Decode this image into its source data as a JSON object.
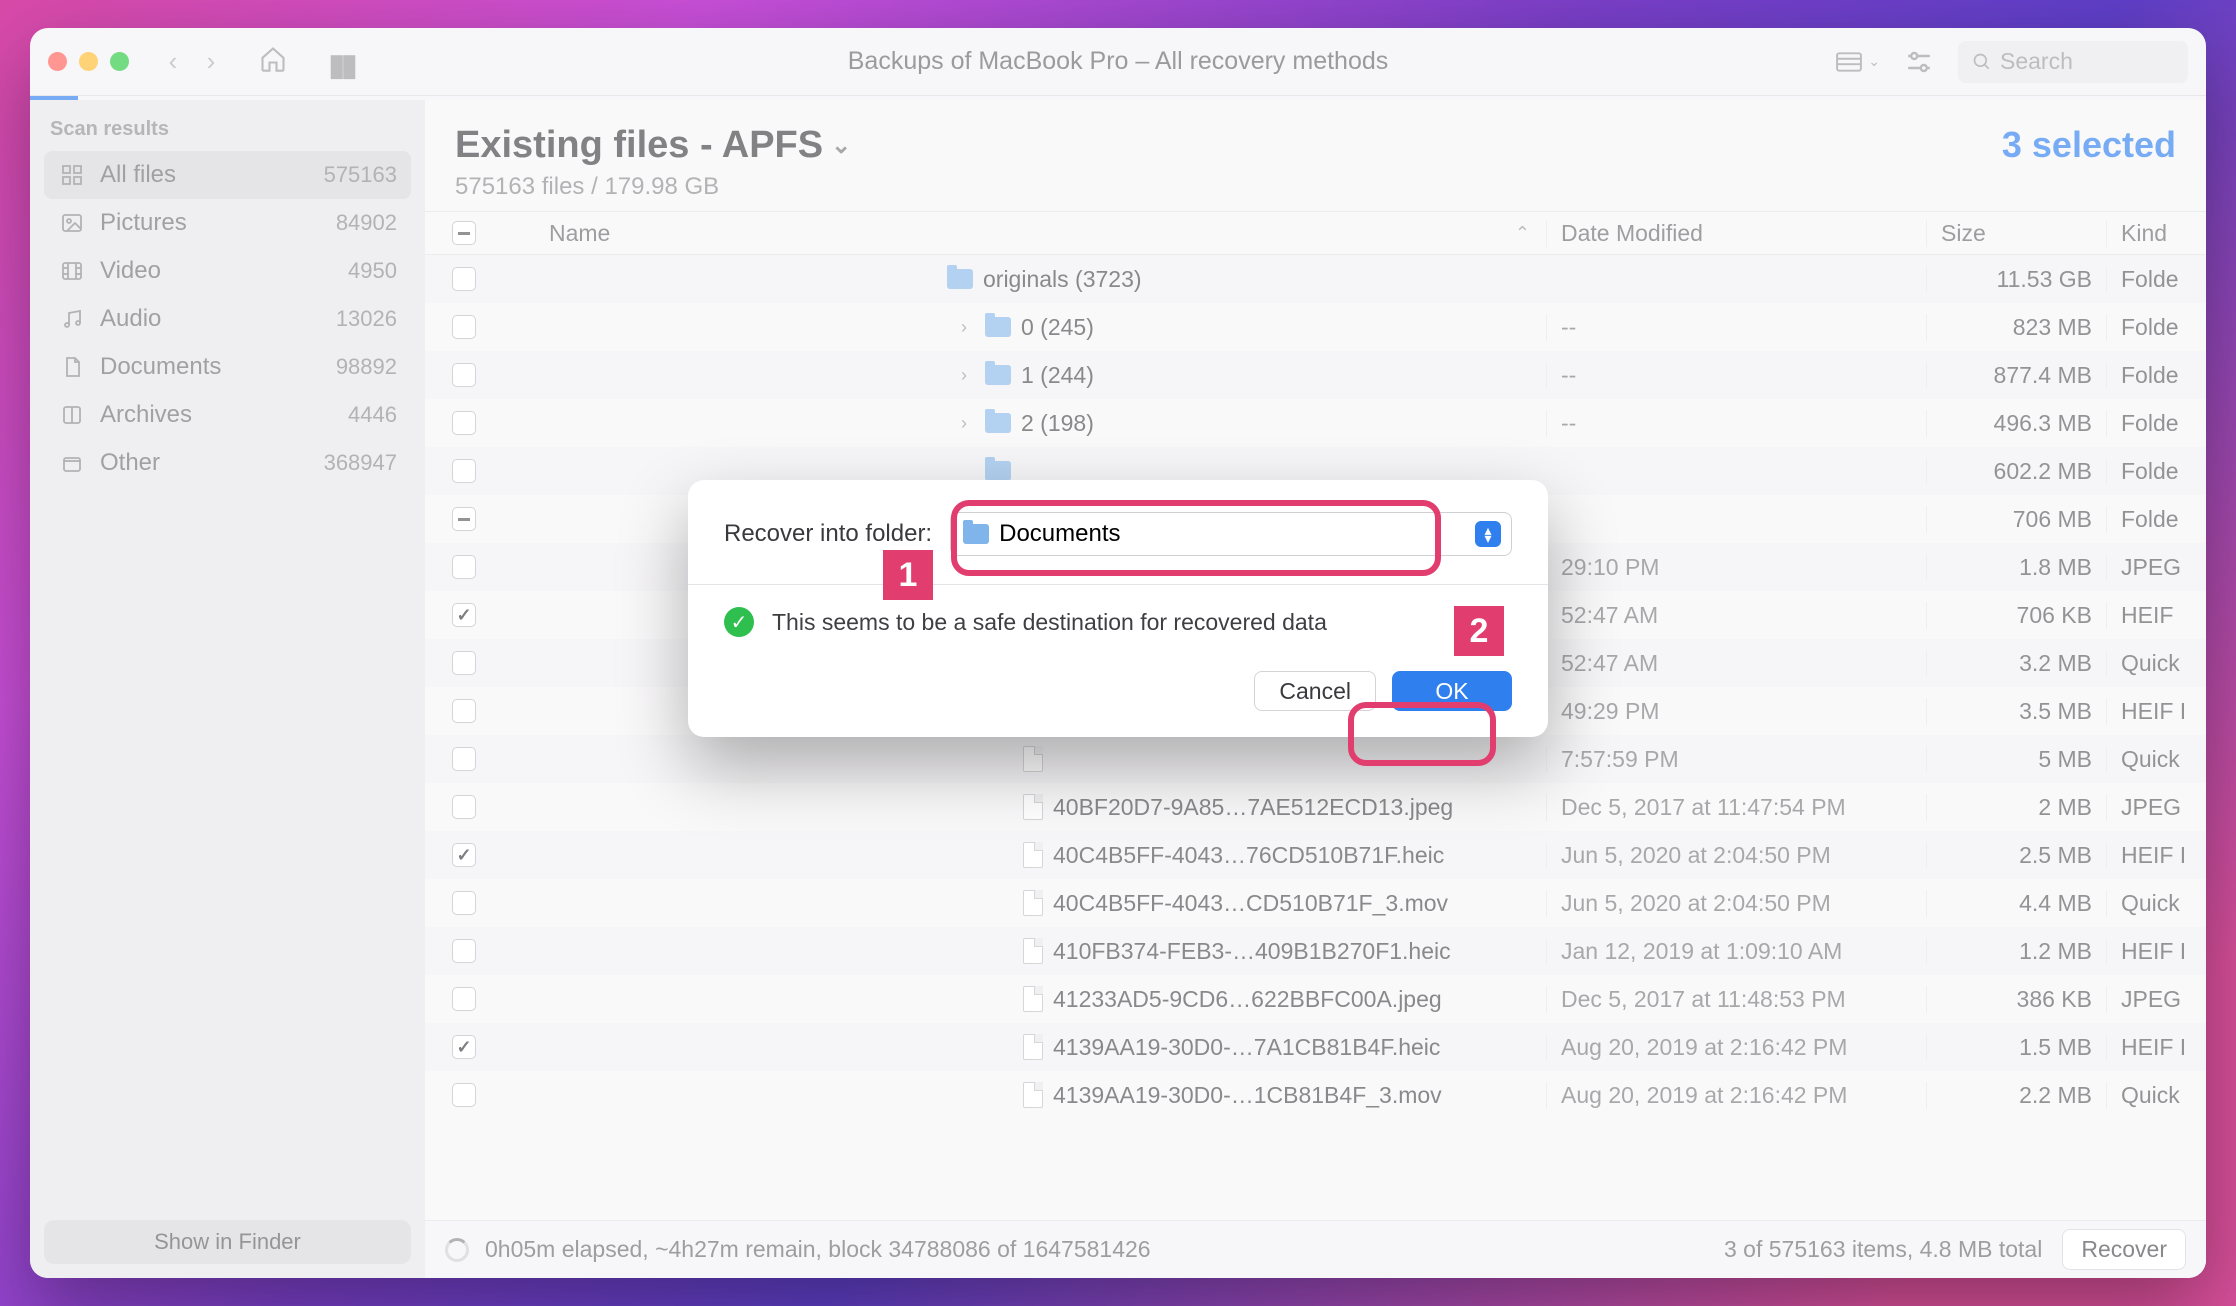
{
  "titlebar": {
    "title": "Backups of MacBook Pro – All recovery methods",
    "search_placeholder": "Search"
  },
  "sidebar": {
    "heading": "Scan results",
    "items": [
      {
        "label": "All files",
        "count": "575163",
        "icon": "grid"
      },
      {
        "label": "Pictures",
        "count": "84902",
        "icon": "image"
      },
      {
        "label": "Video",
        "count": "4950",
        "icon": "film"
      },
      {
        "label": "Audio",
        "count": "13026",
        "icon": "music"
      },
      {
        "label": "Documents",
        "count": "98892",
        "icon": "doc"
      },
      {
        "label": "Archives",
        "count": "4446",
        "icon": "archive"
      },
      {
        "label": "Other",
        "count": "368947",
        "icon": "box"
      }
    ],
    "footer_button": "Show in Finder"
  },
  "main": {
    "title": "Existing files - APFS",
    "subtitle": "575163 files / 179.98 GB",
    "selected_label": "3 selected",
    "columns": {
      "name": "Name",
      "date": "Date Modified",
      "size": "Size",
      "kind": "Kind"
    },
    "rows": [
      {
        "indent": 3,
        "chk": "none",
        "type": "folder",
        "disclosure": "",
        "name": "originals (3723)",
        "date": "",
        "size": "11.53 GB",
        "kind": "Folde"
      },
      {
        "indent": 4,
        "chk": "none",
        "type": "folder",
        "disclosure": ">",
        "name": "0 (245)",
        "date": "--",
        "size": "823 MB",
        "kind": "Folde"
      },
      {
        "indent": 4,
        "chk": "none",
        "type": "folder",
        "disclosure": ">",
        "name": "1 (244)",
        "date": "--",
        "size": "877.4 MB",
        "kind": "Folde"
      },
      {
        "indent": 4,
        "chk": "none",
        "type": "folder",
        "disclosure": ">",
        "name": "2 (198)",
        "date": "--",
        "size": "496.3 MB",
        "kind": "Folde"
      },
      {
        "indent": 4,
        "chk": "none",
        "type": "folder",
        "disclosure": "",
        "name": "",
        "date": "",
        "size": "602.2 MB",
        "kind": "Folde"
      },
      {
        "indent": 4,
        "chk": "minus",
        "type": "folder",
        "disclosure": "",
        "name": "",
        "date": "",
        "size": "706 MB",
        "kind": "Folde"
      },
      {
        "indent": 5,
        "chk": "none",
        "type": "file",
        "disclosure": "",
        "name": "",
        "date": "29:10 PM",
        "size": "1.8 MB",
        "kind": "JPEG"
      },
      {
        "indent": 5,
        "chk": "check",
        "type": "file",
        "disclosure": "",
        "name": "",
        "date": "52:47 AM",
        "size": "706 KB",
        "kind": "HEIF"
      },
      {
        "indent": 5,
        "chk": "none",
        "type": "file",
        "disclosure": "",
        "name": "",
        "date": "52:47 AM",
        "size": "3.2 MB",
        "kind": "Quick"
      },
      {
        "indent": 5,
        "chk": "none",
        "type": "file",
        "disclosure": "",
        "name": "",
        "date": "49:29 PM",
        "size": "3.5 MB",
        "kind": "HEIF I"
      },
      {
        "indent": 5,
        "chk": "none",
        "type": "file",
        "disclosure": "",
        "name": "",
        "date": "7:57:59 PM",
        "size": "5 MB",
        "kind": "Quick"
      },
      {
        "indent": 5,
        "chk": "none",
        "type": "file",
        "disclosure": "",
        "name": "40BF20D7-9A85…7AE512ECD13.jpeg",
        "date": "Dec 5, 2017 at 11:47:54 PM",
        "size": "2 MB",
        "kind": "JPEG"
      },
      {
        "indent": 5,
        "chk": "check",
        "type": "file",
        "disclosure": "",
        "name": "40C4B5FF-4043…76CD510B71F.heic",
        "date": "Jun 5, 2020 at 2:04:50 PM",
        "size": "2.5 MB",
        "kind": "HEIF I"
      },
      {
        "indent": 5,
        "chk": "none",
        "type": "file",
        "disclosure": "",
        "name": "40C4B5FF-4043…CD510B71F_3.mov",
        "date": "Jun 5, 2020 at 2:04:50 PM",
        "size": "4.4 MB",
        "kind": "Quick"
      },
      {
        "indent": 5,
        "chk": "none",
        "type": "file",
        "disclosure": "",
        "name": "410FB374-FEB3-…409B1B270F1.heic",
        "date": "Jan 12, 2019 at 1:09:10 AM",
        "size": "1.2 MB",
        "kind": "HEIF I"
      },
      {
        "indent": 5,
        "chk": "none",
        "type": "file",
        "disclosure": "",
        "name": "41233AD5-9CD6…622BBFC00A.jpeg",
        "date": "Dec 5, 2017 at 11:48:53 PM",
        "size": "386 KB",
        "kind": "JPEG"
      },
      {
        "indent": 5,
        "chk": "check",
        "type": "file",
        "disclosure": "",
        "name": "4139AA19-30D0-…7A1CB81B4F.heic",
        "date": "Aug 20, 2019 at 2:16:42 PM",
        "size": "1.5 MB",
        "kind": "HEIF I"
      },
      {
        "indent": 5,
        "chk": "none",
        "type": "file",
        "disclosure": "",
        "name": "4139AA19-30D0-…1CB81B4F_3.mov",
        "date": "Aug 20, 2019 at 2:16:42 PM",
        "size": "2.2 MB",
        "kind": "Quick"
      }
    ]
  },
  "footer": {
    "status": "0h05m elapsed, ~4h27m remain, block 34788086 of 1647581426",
    "summary": "3 of 575163 items, 4.8 MB total",
    "recover_label": "Recover"
  },
  "modal": {
    "label": "Recover into folder:",
    "select_value": "Documents",
    "message": "This seems to be a safe destination for recovered data",
    "cancel": "Cancel",
    "ok": "OK"
  },
  "annotations": {
    "badge1": "1",
    "badge2": "2"
  }
}
